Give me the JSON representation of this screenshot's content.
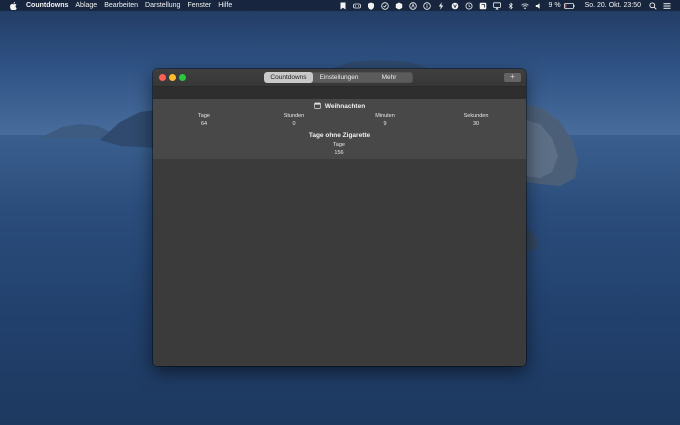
{
  "menubar": {
    "app_name": "Countdowns",
    "menus": [
      "Ablage",
      "Bearbeiten",
      "Darstellung",
      "Fenster",
      "Hilfe"
    ],
    "battery_percent": "9 %",
    "clock": "So. 20. Okt.  23:50",
    "status_icons": [
      "bookmark-icon",
      "gamepad-icon",
      "shield-icon",
      "check-circle-icon",
      "box-icon",
      "a-icon",
      "info-icon",
      "lightning-icon",
      "v-icon",
      "time-machine-icon",
      "box-icon-2",
      "airplay-icon",
      "bluetooth-icon",
      "wifi-icon",
      "volume-icon",
      "battery-icon",
      "search-icon",
      "control-center-icon"
    ]
  },
  "window": {
    "tabs": [
      {
        "label": "Countdowns",
        "selected": true
      },
      {
        "label": "Einstellungen",
        "selected": false
      },
      {
        "label": "Mehr",
        "selected": false
      }
    ],
    "add_button": "+",
    "countdowns": [
      {
        "title": "Weihnachten",
        "icon": "calendar-icon",
        "units": [
          {
            "label": "Tage",
            "value": "64"
          },
          {
            "label": "Stunden",
            "value": "0"
          },
          {
            "label": "Minuten",
            "value": "9"
          },
          {
            "label": "Sekunden",
            "value": "30"
          }
        ]
      },
      {
        "title": "Tage ohne Zigarette",
        "units": [
          {
            "label": "Tage",
            "value": "156"
          }
        ]
      }
    ]
  },
  "colors": {
    "window_bg": "#3a3a3a",
    "list_bg": "#484848",
    "selected_tab": "#c9c9c9",
    "close": "#fe5f57",
    "minimize": "#febc2e",
    "maximize": "#29c840"
  }
}
